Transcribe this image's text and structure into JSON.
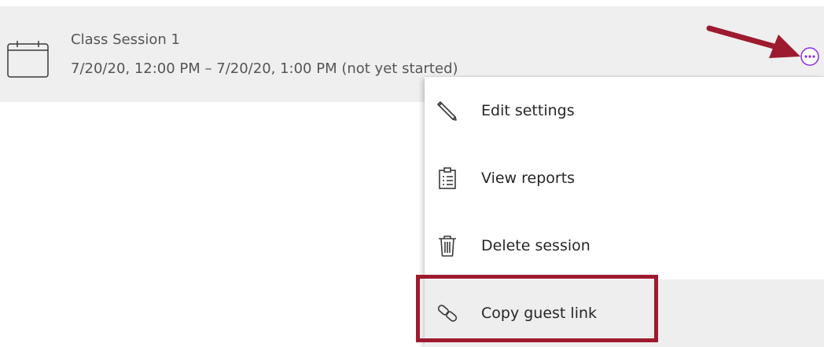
{
  "session": {
    "title": "Class Session 1",
    "time": "7/20/20, 12:00 PM – 7/20/20, 1:00 PM (not yet started)",
    "icon": "calendar-icon",
    "more_icon": "more-options-icon"
  },
  "menu": {
    "items": [
      {
        "label": "Edit settings",
        "icon": "pencil-icon"
      },
      {
        "label": "View reports",
        "icon": "clipboard-report-icon"
      },
      {
        "label": "Delete session",
        "icon": "trash-icon"
      },
      {
        "label": "Copy guest link",
        "icon": "link-icon",
        "highlighted": true
      }
    ]
  },
  "annotations": {
    "arrow_target": "more-options-button",
    "highlight_target": "Copy guest link"
  },
  "colors": {
    "row_background": "#efefef",
    "annotation": "#9e1b2f",
    "more_button": "#8a2be2",
    "text_muted": "#555555",
    "text_menu": "#262626"
  }
}
